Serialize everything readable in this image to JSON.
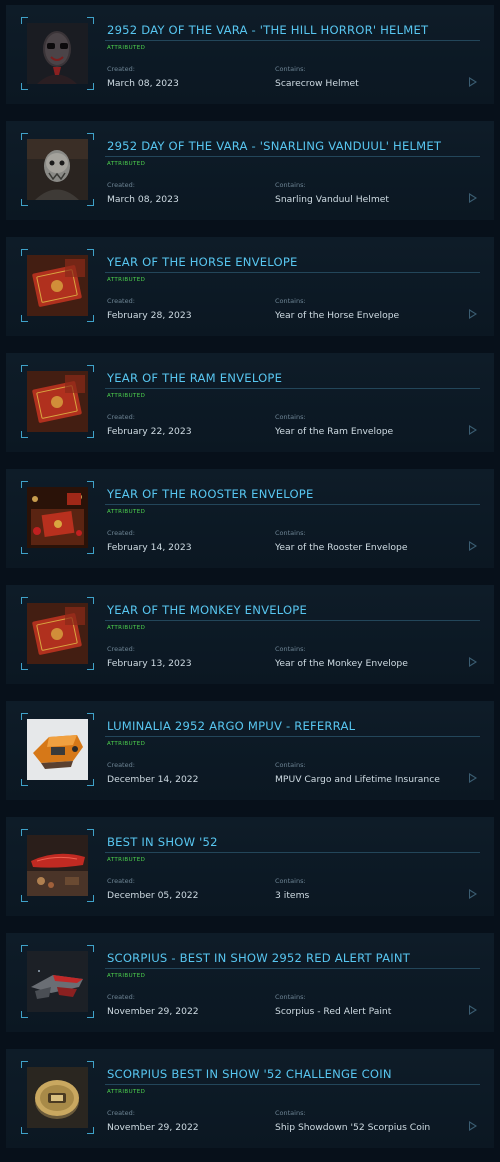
{
  "pledges": [
    {
      "title": "2952 DAY OF THE VARA - 'THE HILL HORROR' HELMET",
      "badge": "ATTRIBUTED",
      "created_label": "Created:",
      "created": "March 08, 2023",
      "contains_label": "Contains:",
      "contains": "Scarecrow Helmet",
      "thumbnail": "hill-horror-helmet"
    },
    {
      "title": "2952 DAY OF THE VARA - 'SNARLING VANDUUL' HELMET",
      "badge": "ATTRIBUTED",
      "created_label": "Created:",
      "created": "March 08, 2023",
      "contains_label": "Contains:",
      "contains": "Snarling Vanduul Helmet",
      "thumbnail": "snarling-vanduul-helmet"
    },
    {
      "title": "YEAR OF THE HORSE ENVELOPE",
      "badge": "ATTRIBUTED",
      "created_label": "Created:",
      "created": "February 28, 2023",
      "contains_label": "Contains:",
      "contains": "Year of the Horse Envelope",
      "thumbnail": "red-envelope"
    },
    {
      "title": "YEAR OF THE RAM ENVELOPE",
      "badge": "ATTRIBUTED",
      "created_label": "Created:",
      "created": "February 22, 2023",
      "contains_label": "Contains:",
      "contains": "Year of the Ram Envelope",
      "thumbnail": "red-envelope"
    },
    {
      "title": "YEAR OF THE ROOSTER ENVELOPE",
      "badge": "ATTRIBUTED",
      "created_label": "Created:",
      "created": "February 14, 2023",
      "contains_label": "Contains:",
      "contains": "Year of the Rooster Envelope",
      "thumbnail": "red-envelope-table"
    },
    {
      "title": "YEAR OF THE MONKEY ENVELOPE",
      "badge": "ATTRIBUTED",
      "created_label": "Created:",
      "created": "February 13, 2023",
      "contains_label": "Contains:",
      "contains": "Year of the Monkey Envelope",
      "thumbnail": "red-envelope"
    },
    {
      "title": "LUMINALIA 2952 ARGO MPUV - REFERRAL",
      "badge": "ATTRIBUTED",
      "created_label": "Created:",
      "created": "December 14, 2022",
      "contains_label": "Contains:",
      "contains": "MPUV Cargo and Lifetime Insurance",
      "thumbnail": "argo-mpuv-ship"
    },
    {
      "title": "BEST IN SHOW '52",
      "badge": "ATTRIBUTED",
      "created_label": "Created:",
      "created": "December 05, 2022",
      "contains_label": "Contains:",
      "contains": "3 items",
      "thumbnail": "red-ship-display"
    },
    {
      "title": "SCORPIUS - BEST IN SHOW 2952 RED ALERT PAINT",
      "badge": "ATTRIBUTED",
      "created_label": "Created:",
      "created": "November 29, 2022",
      "contains_label": "Contains:",
      "contains": "Scorpius - Red Alert Paint",
      "thumbnail": "scorpius-ship"
    },
    {
      "title": "SCORPIUS BEST IN SHOW '52 CHALLENGE COIN",
      "badge": "ATTRIBUTED",
      "created_label": "Created:",
      "created": "November 29, 2022",
      "contains_label": "Contains:",
      "contains": "Ship Showdown '52 Scorpius Coin",
      "thumbnail": "challenge-coin"
    }
  ]
}
